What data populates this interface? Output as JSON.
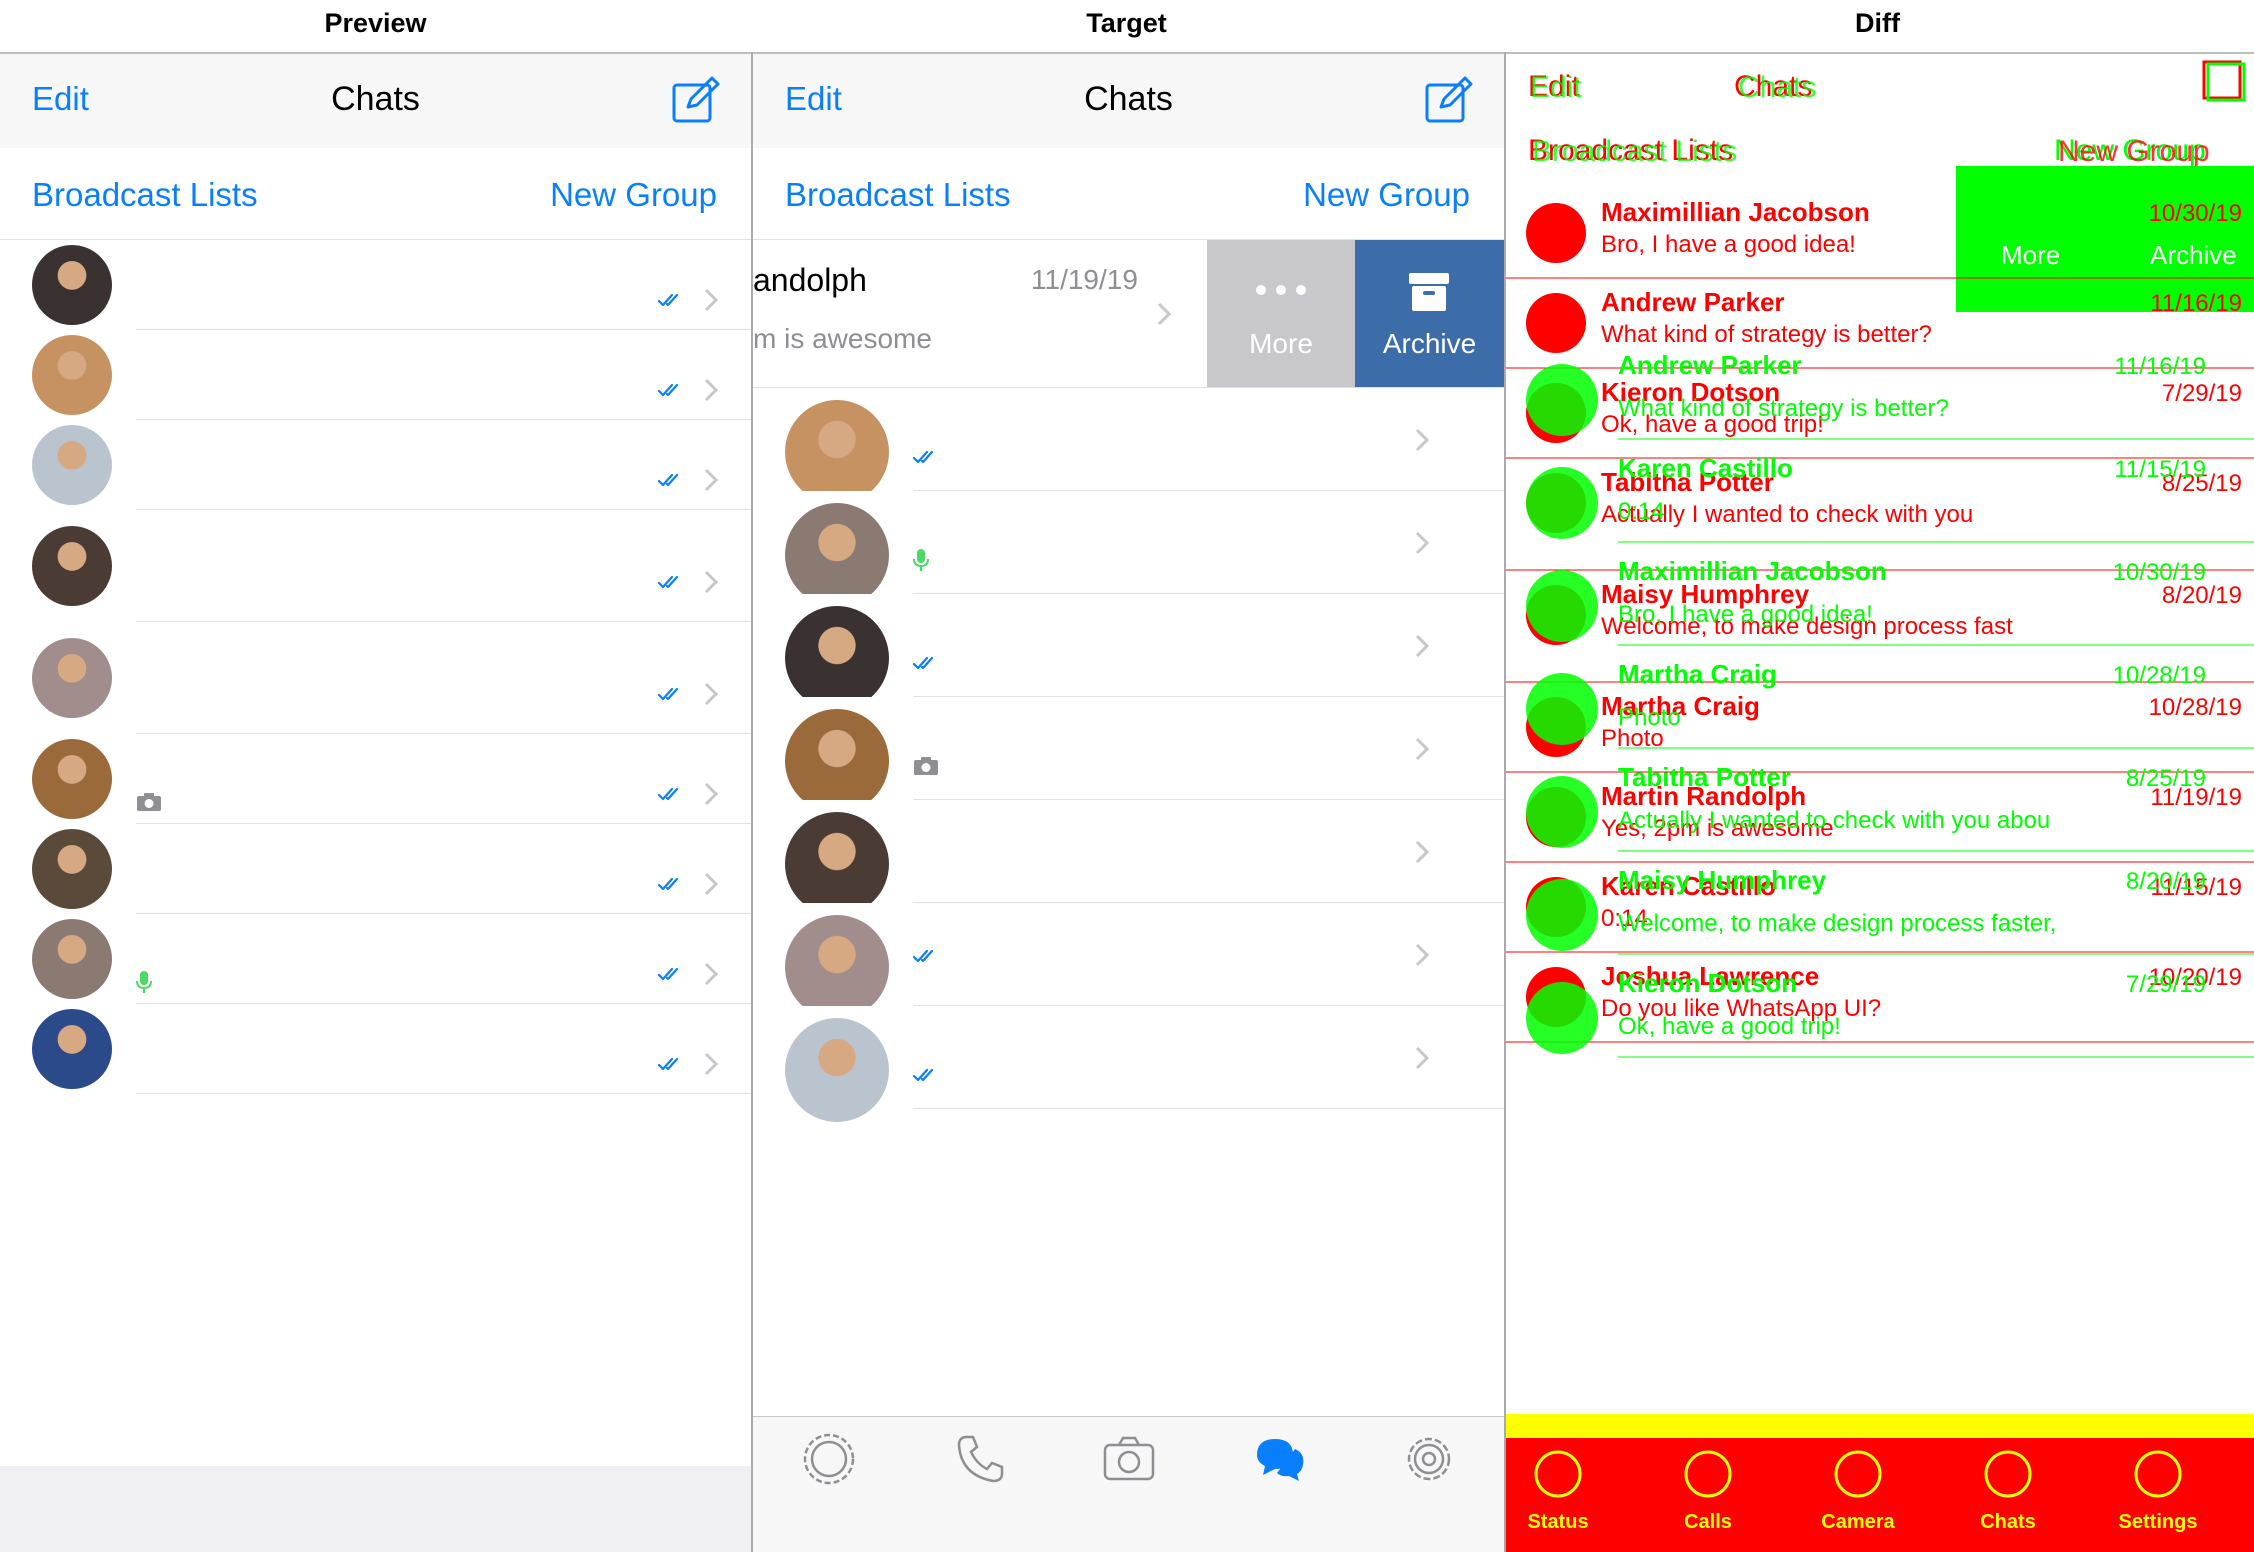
{
  "labels": {
    "preview": "Preview",
    "target": "Target",
    "diff": "Diff"
  },
  "colors": {
    "accent": "#0a7ffe",
    "archive": "#3d6da8",
    "more": "#c7c7cc",
    "diff_red": "#ff0000",
    "diff_green": "#00ff00",
    "diff_yellow": "#ffff00"
  },
  "header": {
    "edit": "Edit",
    "title": "Chats",
    "compose_icon": "compose-icon"
  },
  "subbar": {
    "broadcast": "Broadcast Lists",
    "new_group": "New Group"
  },
  "preview_chats": [
    {
      "name": "Maximillian Jacobson",
      "date": "10/30/19",
      "message": "Bro, I have a good idea!",
      "avatar": "#3a3230"
    },
    {
      "name": "Andrew Parker",
      "date": "11/16/19",
      "message": "What kind of strategy is better?",
      "avatar": "#c79262"
    },
    {
      "name": "Kieron Dotson",
      "date": "7/29/19",
      "message": "Ok, have a good trip!",
      "avatar": "#b9c4cf"
    },
    {
      "name": "Tabitha Potter",
      "date": "8/25/19",
      "message": "Actually I wanted to check with you about your online business plan on our…",
      "avatar": "#4b3b35"
    },
    {
      "name": "Maisy Humphrey",
      "date": "8/20/19",
      "message": "Welcome, to make design process faster, look at Pixsellz",
      "avatar": "#a08d8c"
    },
    {
      "name": "Martha Craig",
      "date": "10/28/19",
      "message": "Photo",
      "avatar": "#9a6a3a"
    },
    {
      "name": "Martin Randolph",
      "date": "11/19/19",
      "message": "Yes, 2pm is awesome",
      "avatar": "#5a4a3a"
    },
    {
      "name": "Karen Castillo",
      "date": "11/15/19",
      "message": "0:14",
      "avatar": "#8a7a72"
    },
    {
      "name": "Joshua Lawrence",
      "date": "10/20/19",
      "message": "Do you like WhatsApp UI?",
      "avatar": "#2a4a8a"
    }
  ],
  "target_swiped": {
    "name": "andolph",
    "date": "11/19/19",
    "message": "m is awesome",
    "more": "More",
    "archive": "Archive"
  },
  "target_chats": [
    {
      "name": "Andrew Parker",
      "date": "11/16/19",
      "message": "What kind of strategy is better?",
      "avatar": "#c79262"
    },
    {
      "name": "Karen Castillo",
      "date": "11/15/19",
      "message": "0:14",
      "avatar": "#8a7a72"
    },
    {
      "name": "Maximillian Jacobson",
      "date": "10/30/19",
      "message": "Bro, I have a good idea!",
      "avatar": "#3a3230"
    },
    {
      "name": "Martha Craig",
      "date": "10/28/19",
      "message": "Photo",
      "avatar": "#9a6a3a"
    },
    {
      "name": "Tabitha Potter",
      "date": "8/25/19",
      "message": "Actually I wanted to check with you about your online business plan on our…",
      "avatar": "#4b3b35"
    },
    {
      "name": "Maisy Humphrey",
      "date": "8/20/19",
      "message": "Welcome, to make design process faster, look at Pixsellz",
      "avatar": "#a08d8c"
    },
    {
      "name": "Kieron Dotson",
      "date": "7/29/19",
      "message": "Ok, have a good trip!",
      "avatar": "#b9c4cf"
    }
  ],
  "tabs": [
    {
      "label": "Status",
      "icon": "status-icon"
    },
    {
      "label": "Calls",
      "icon": "phone-icon"
    },
    {
      "label": "Camera",
      "icon": "camera-icon"
    },
    {
      "label": "Chats",
      "icon": "chats-icon",
      "active": true
    },
    {
      "label": "Settings",
      "icon": "gear-icon"
    }
  ]
}
